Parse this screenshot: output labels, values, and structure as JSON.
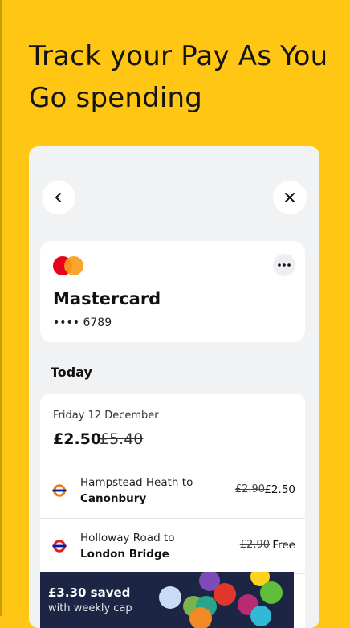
{
  "headline": "Track your Pay As You Go spending",
  "nav": {
    "back_icon": "chevron-left-icon",
    "close_icon": "close-icon"
  },
  "card": {
    "brand": "Mastercard",
    "number": "•••• 6789",
    "more_icon": "more-horizontal-icon",
    "colors": {
      "red": "#eb001b",
      "orange": "#f79e1b"
    }
  },
  "section": {
    "title": "Today"
  },
  "day": {
    "label": "Friday 12 December",
    "amount": "£2.50",
    "original": "£5.40"
  },
  "journeys": [
    {
      "from": "Hampstead Heath to",
      "to": "Canonbury",
      "original_fare": "£2.90",
      "paid": "£2.50",
      "icon": "overground-roundel-icon"
    },
    {
      "from": "Holloway Road to",
      "to": "London Bridge",
      "original_fare": "£2.90",
      "paid": "Free",
      "icon": "tube-roundel-icon"
    }
  ],
  "savings": {
    "title": "£3.30 saved",
    "subtitle": "with weekly cap"
  },
  "colors": {
    "background": "#ffc714",
    "overground": "#ee7c0e",
    "underground": "#dc241f",
    "roundel_bar": "#0019a8",
    "banner": "#1c2543"
  }
}
